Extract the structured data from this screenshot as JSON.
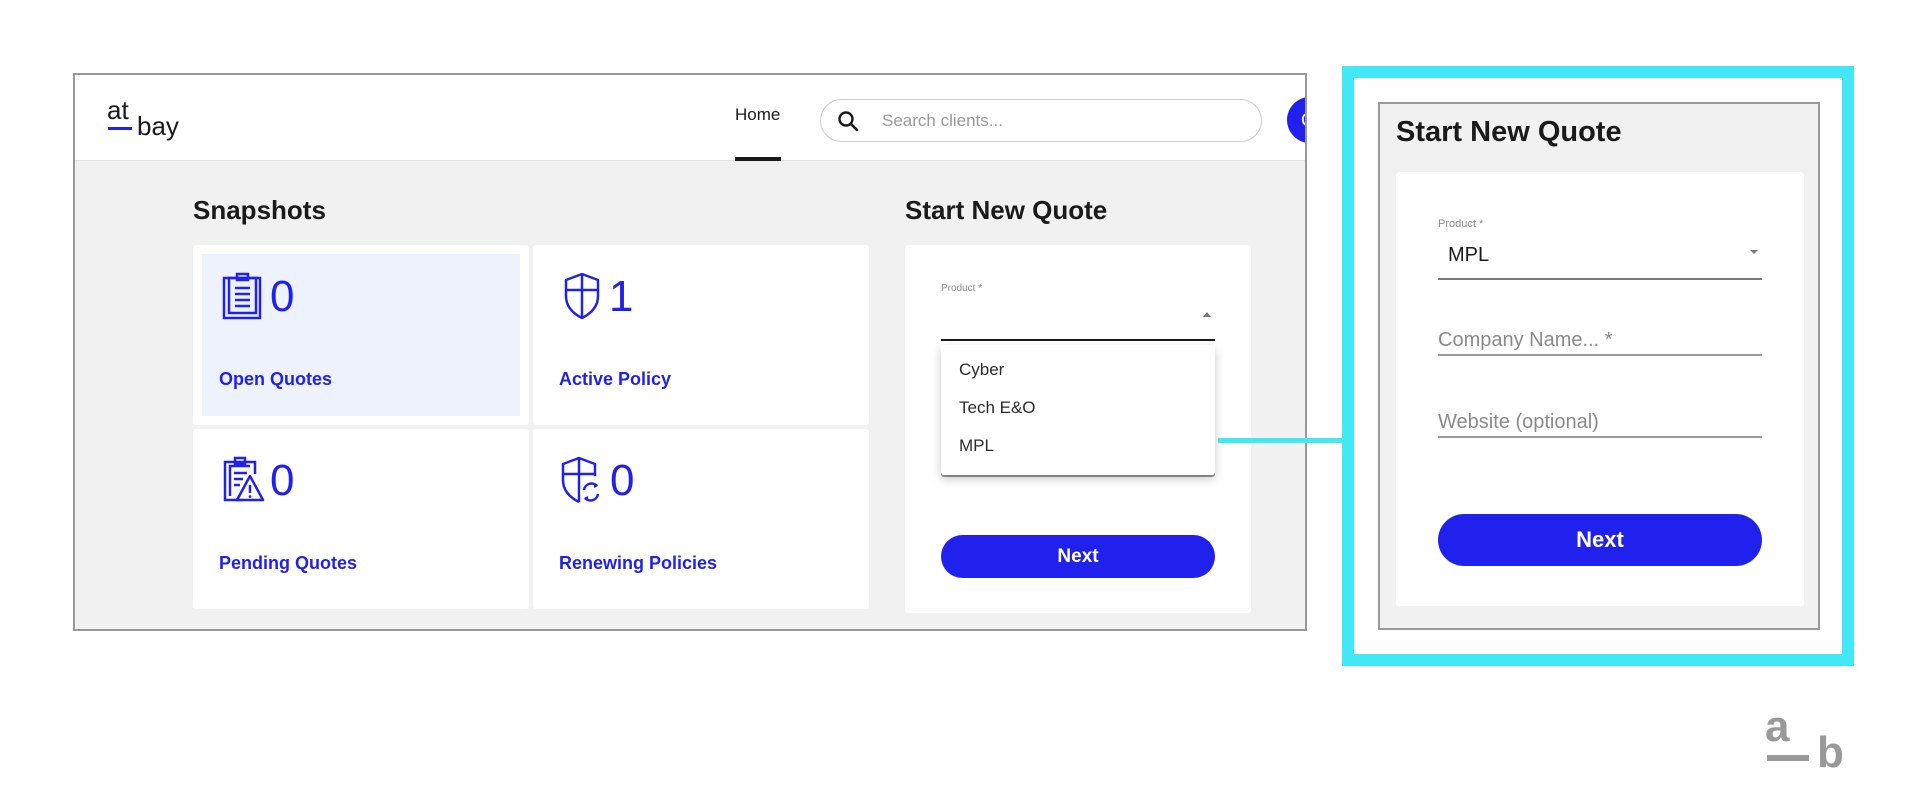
{
  "app": {
    "logo_top": "at",
    "logo_bottom": "bay",
    "nav": {
      "home_label": "Home"
    },
    "search": {
      "placeholder": "Search clients..."
    },
    "avatar_initial": "C"
  },
  "snapshots": {
    "title": "Snapshots",
    "cards": [
      {
        "label": "Open Quotes",
        "count": "0",
        "icon": "clipboard-icon",
        "selected": true
      },
      {
        "label": "Active Policy",
        "count": "1",
        "icon": "shield-icon",
        "selected": false
      },
      {
        "label": "Pending Quotes",
        "count": "0",
        "icon": "clipboard-warning-icon",
        "selected": false
      },
      {
        "label": "Renewing Policies",
        "count": "0",
        "icon": "shield-renew-icon",
        "selected": false
      }
    ]
  },
  "quote": {
    "title": "Start New Quote",
    "product_label": "Product *",
    "product_value": "",
    "options": [
      "Cyber",
      "Tech E&O",
      "MPL"
    ],
    "next_label": "Next"
  },
  "callout": {
    "title": "Start New Quote",
    "product_label": "Product *",
    "product_value": "MPL",
    "company_placeholder": "Company Name... *",
    "website_placeholder": "Website (optional)",
    "next_label": "Next"
  },
  "mark": {
    "a": "a",
    "b": "b"
  },
  "colors": {
    "brand_blue": "#2121ee",
    "highlight_cyan": "#42e8f5",
    "selected_card_bg": "#edf2fd",
    "page_bg": "#f1f1f1"
  }
}
